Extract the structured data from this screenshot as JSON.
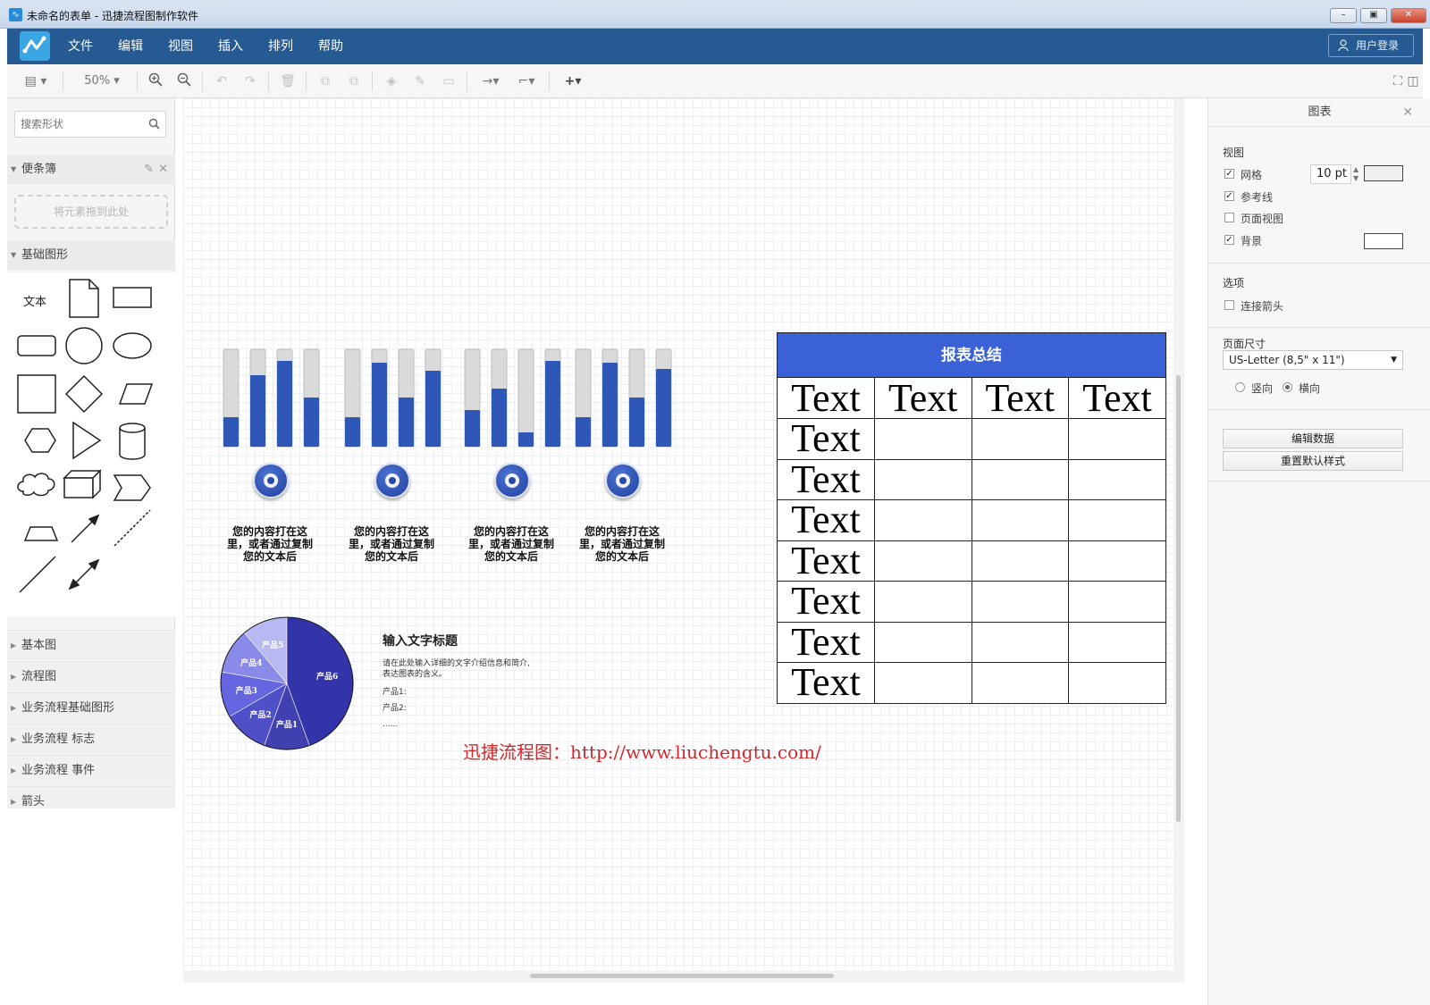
{
  "window": {
    "title": "未命名的表单 - 迅捷流程图制作软件"
  },
  "menu": {
    "items": [
      "文件",
      "编辑",
      "视图",
      "插入",
      "排列",
      "帮助"
    ],
    "login": "用户登录"
  },
  "toolbar": {
    "zoom": "50%"
  },
  "left_panel": {
    "search_placeholder": "搜索形状",
    "notes_title": "便条簿",
    "drop_hint": "将元素拖到此处",
    "basic_shapes_title": "基础图形",
    "text_shape_label": "文本",
    "categories": [
      "基本图",
      "流程图",
      "业务流程基础图形",
      "业务流程 标志",
      "业务流程 事件",
      "箭头"
    ]
  },
  "canvas": {
    "bar_groups": [
      {
        "icon": "globe-icon",
        "values": [
          0.3,
          0.73,
          0.88,
          0.5
        ],
        "caption": [
          "您的内容打在这",
          "里，或者通过复制",
          "您的文本后"
        ]
      },
      {
        "icon": "briefcase-icon",
        "values": [
          0.3,
          0.86,
          0.5,
          0.78
        ],
        "caption": [
          "您的内容打在这",
          "里，或者通过复制",
          "您的文本后"
        ]
      },
      {
        "icon": "gears-icon",
        "values": [
          0.38,
          0.6,
          0.15,
          0.88
        ],
        "caption": [
          "您的内容打在这",
          "里，或者通过复制",
          "您的文本后"
        ]
      },
      {
        "icon": "hand-coin-icon",
        "values": [
          0.3,
          0.86,
          0.5,
          0.8
        ],
        "caption": [
          "您的内容打在这",
          "里，或者通过复制",
          "您的文本后"
        ]
      }
    ],
    "pie": {
      "slices": [
        {
          "label": "产品1",
          "value": 1.0,
          "color": "#4040b0"
        },
        {
          "label": "产品2",
          "value": 1.0,
          "color": "#4f4fc8"
        },
        {
          "label": "产品3",
          "value": 1.0,
          "color": "#6565e0"
        },
        {
          "label": "产品4",
          "value": 1.0,
          "color": "#8a8ae8"
        },
        {
          "label": "产品5",
          "value": 1.0,
          "color": "#b8b8f2"
        },
        {
          "label": "产品6",
          "value": 4.0,
          "color": "#3333aa"
        }
      ],
      "title": "输入文字标题",
      "desc_line1": "请在此处输入详细的文字介绍信息和简介,",
      "desc_line2": "表达图表的含义。",
      "item1": "产品1:",
      "item2": "产品2:",
      "ellipsis": "......"
    },
    "watermark": "迅捷流程图：http://www.liuchengtu.com/",
    "report": {
      "title": "报表总结",
      "rows": [
        [
          "Text",
          "Text",
          "Text",
          "Text"
        ],
        [
          "Text",
          "",
          "",
          ""
        ],
        [
          "Text",
          "",
          "",
          ""
        ],
        [
          "Text",
          "",
          "",
          ""
        ],
        [
          "Text",
          "",
          "",
          ""
        ],
        [
          "Text",
          "",
          "",
          ""
        ],
        [
          "Text",
          "",
          "",
          ""
        ],
        [
          "Text",
          "",
          "",
          ""
        ]
      ]
    }
  },
  "right_panel": {
    "title": "图表",
    "view_label": "视图",
    "grid_label": "网格",
    "grid_size": "10 pt",
    "guides_label": "参考线",
    "page_view_label": "页面视图",
    "background_label": "背景",
    "options_label": "选项",
    "connect_arrows_label": "连接箭头",
    "page_size_label": "页面尺寸",
    "page_size_value": "US-Letter (8,5\" x 11\")",
    "portrait_label": "竖向",
    "landscape_label": "横向",
    "edit_data_button": "编辑数据",
    "reset_style_button": "重置默认样式",
    "checked": {
      "grid": true,
      "guides": true,
      "page_view": false,
      "background": true,
      "connect_arrows": false
    },
    "orientation": "landscape"
  },
  "colors": {
    "menubar": "#265a92",
    "bar_fill": "#2f57b8",
    "report_header": "#3a62d6",
    "watermark": "#d2272a"
  }
}
